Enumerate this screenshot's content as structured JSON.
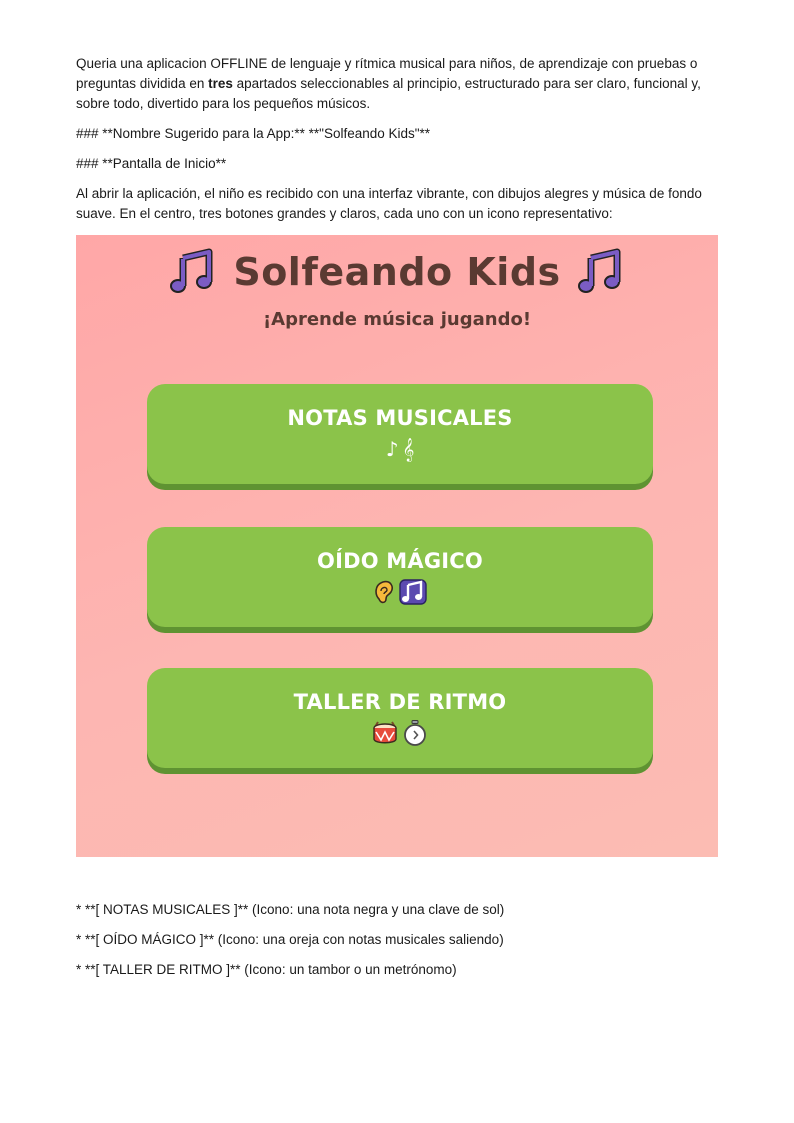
{
  "intro": {
    "p1_before": "Queria una aplicacion OFFLINE de lenguaje y rítmica musical para niños, de aprendizaje con pruebas o preguntas dividida en ",
    "p1_bold": "tres",
    "p1_after": " apartados seleccionables al principio, estructurado para ser claro, funcional y, sobre todo, divertido para los pequeños músicos.",
    "h1": "### **Nombre Sugerido para la App:** **\"Solfeando Kids\"**",
    "h2": "### **Pantalla de Inicio**",
    "p2": "Al abrir la aplicación, el niño es recibido con una interfaz vibrante, con dibujos alegres y música de fondo suave. En el centro, tres botones grandes y claros, cada uno con un icono representativo:"
  },
  "app": {
    "title": "Solfeando Kids",
    "subtitle": "¡Aprende música jugando!",
    "buttons": [
      {
        "label": "NOTAS MUSICALES",
        "icons": [
          "musical-note-icon",
          "treble-clef-icon"
        ],
        "glyphs": [
          "♪",
          "𝄞"
        ]
      },
      {
        "label": "OÍDO MÁGICO",
        "icons": [
          "ear-icon",
          "musical-notes-icon"
        ]
      },
      {
        "label": "TALLER DE RITMO",
        "icons": [
          "drum-icon",
          "stopwatch-icon"
        ]
      }
    ],
    "colors": {
      "background": "#ffa7a7",
      "button": "#8bc34a",
      "button_shadow": "#5f9332",
      "title": "#5a3a32",
      "note_icon": "#7b5cc4"
    }
  },
  "bullets": [
    "* **[ NOTAS MUSICALES ]** (Icono: una nota negra y una clave de sol)",
    "* **[ OÍDO MÁGICO ]** (Icono: una oreja con notas musicales saliendo)",
    "* **[ TALLER DE RITMO ]** (Icono: un tambor o un metrónomo)"
  ]
}
